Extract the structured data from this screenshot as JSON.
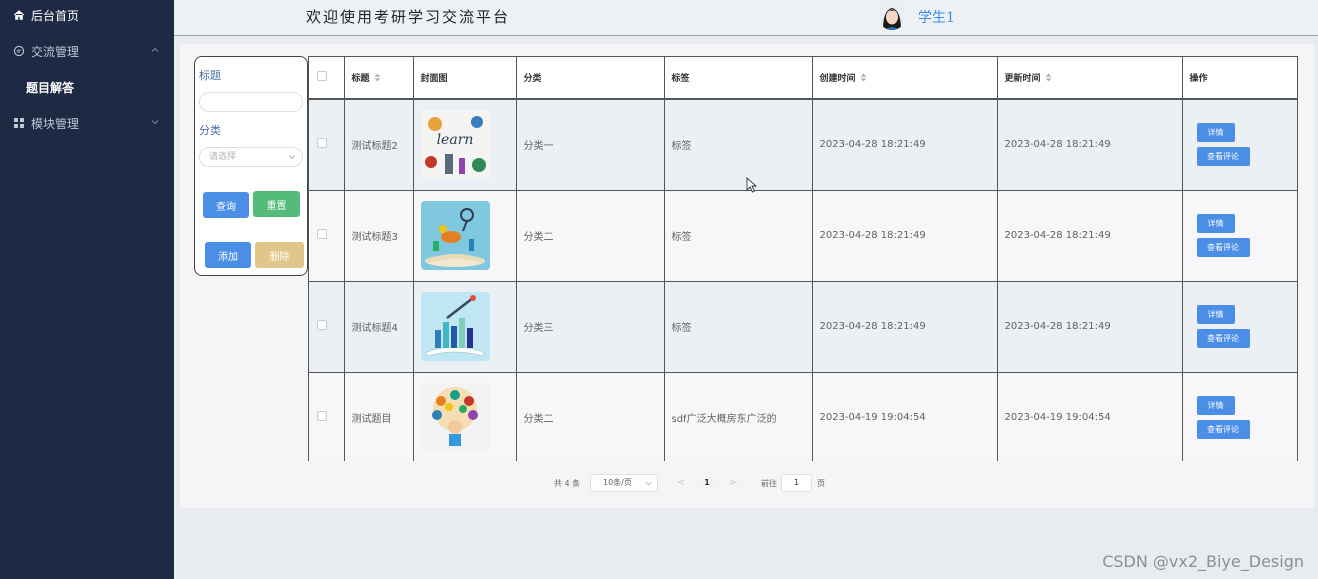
{
  "sidebar": {
    "items": [
      {
        "label": "后台首页",
        "icon": "home-icon"
      },
      {
        "label": "交流管理",
        "icon": "chat-icon"
      },
      {
        "label": "题目解答"
      },
      {
        "label": "模块管理",
        "icon": "grid-icon"
      }
    ]
  },
  "header": {
    "welcome": "欢迎使用考研学习交流平台",
    "username": "学生1"
  },
  "search": {
    "title_label": "标题",
    "title_value": "",
    "category_label": "分类",
    "category_placeholder": "请选择",
    "query_button": "查询",
    "reset_button": "重置",
    "add_button": "添加",
    "delete_button": "删除"
  },
  "table": {
    "columns": [
      "标题",
      "封面图",
      "分类",
      "标签",
      "创建时间",
      "更新时间",
      "操作"
    ],
    "rows": [
      {
        "title": "测试标题2",
        "cover": "learn-cover",
        "category": "分类一",
        "tag": "标签",
        "created": "2023-04-28 18:21:49",
        "updated": "2023-04-28 18:21:49"
      },
      {
        "title": "测试标题3",
        "cover": "book-lab-cover",
        "category": "分类二",
        "tag": "标签",
        "created": "2023-04-28 18:21:49",
        "updated": "2023-04-28 18:21:49"
      },
      {
        "title": "测试标题4",
        "cover": "book-city-cover",
        "category": "分类三",
        "tag": "标签",
        "created": "2023-04-28 18:21:49",
        "updated": "2023-04-28 18:21:49"
      },
      {
        "title": "测试题目",
        "cover": "thinking-kid-cover",
        "category": "分类二",
        "tag": "sdf广泛大概房东广泛的",
        "created": "2023-04-19 19:04:54",
        "updated": "2023-04-19 19:04:54"
      }
    ],
    "detail_button": "详情",
    "comment_button": "查看评论"
  },
  "pagination": {
    "total": "共 4 条",
    "page_size": "10条/页",
    "prev": "<",
    "current_page": "1",
    "next": ">",
    "goto_label": "前往",
    "goto_value": "1",
    "goto_unit": "页"
  },
  "watermark": "CSDN @vx2_Biye_Design",
  "colors": {
    "sidebar_bg": "#1e2a44",
    "primary": "#4b8ee6",
    "success": "#55bb7a",
    "warning": "#e0c68a"
  }
}
